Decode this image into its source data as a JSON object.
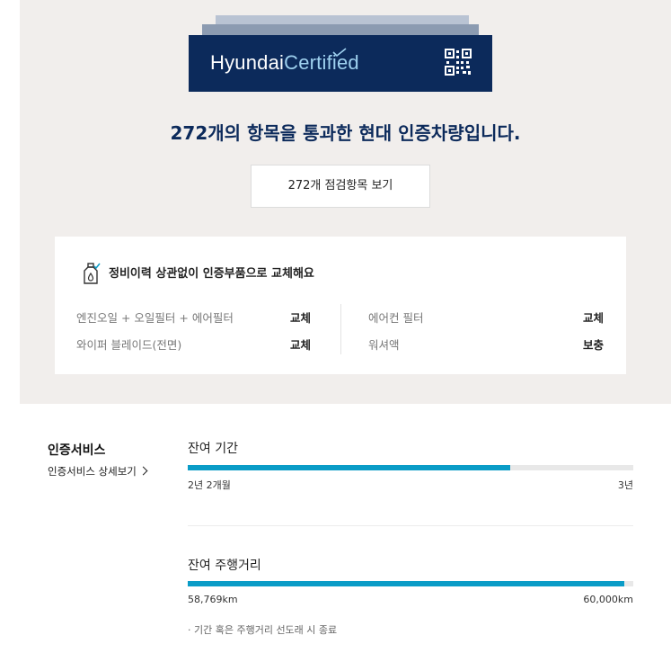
{
  "badge": {
    "brand_primary": "Hyundai",
    "brand_secondary": "Certified",
    "icons": [
      "checkmark-icon",
      "qr-code-icon"
    ],
    "colors": {
      "navy": "#0c2a5b",
      "certified_text": "#9fd1ef"
    }
  },
  "headline": "272개의 항목을 통과한 현대 인증차량입니다.",
  "inspection_button_label": "272개 점검항목 보기",
  "parts": {
    "title": "정비이력 상관없이 인증부품으로 교체해요",
    "icon": "oil-bottle-icon",
    "items": [
      {
        "name": "엔진오일 + 오일필터 + 에어필터",
        "status": "교체"
      },
      {
        "name": "와이퍼 블레이드(전면)",
        "status": "교체"
      },
      {
        "name": "에어컨 필터",
        "status": "교체"
      },
      {
        "name": "워셔액",
        "status": "보충"
      }
    ]
  },
  "service": {
    "title": "인증서비스",
    "detail_link": "인증서비스 상세보기"
  },
  "metrics": [
    {
      "label": "잔여 기간",
      "current": "2년 2개월",
      "max": "3년",
      "progress": 0.723
    },
    {
      "label": "잔여 주행거리",
      "current": "58,769km",
      "max": "60,000km",
      "progress": 0.979
    }
  ],
  "footnote": "·  기간 혹은 주행거리 선도래 시 종료",
  "accent_color": "#0a9cc7"
}
